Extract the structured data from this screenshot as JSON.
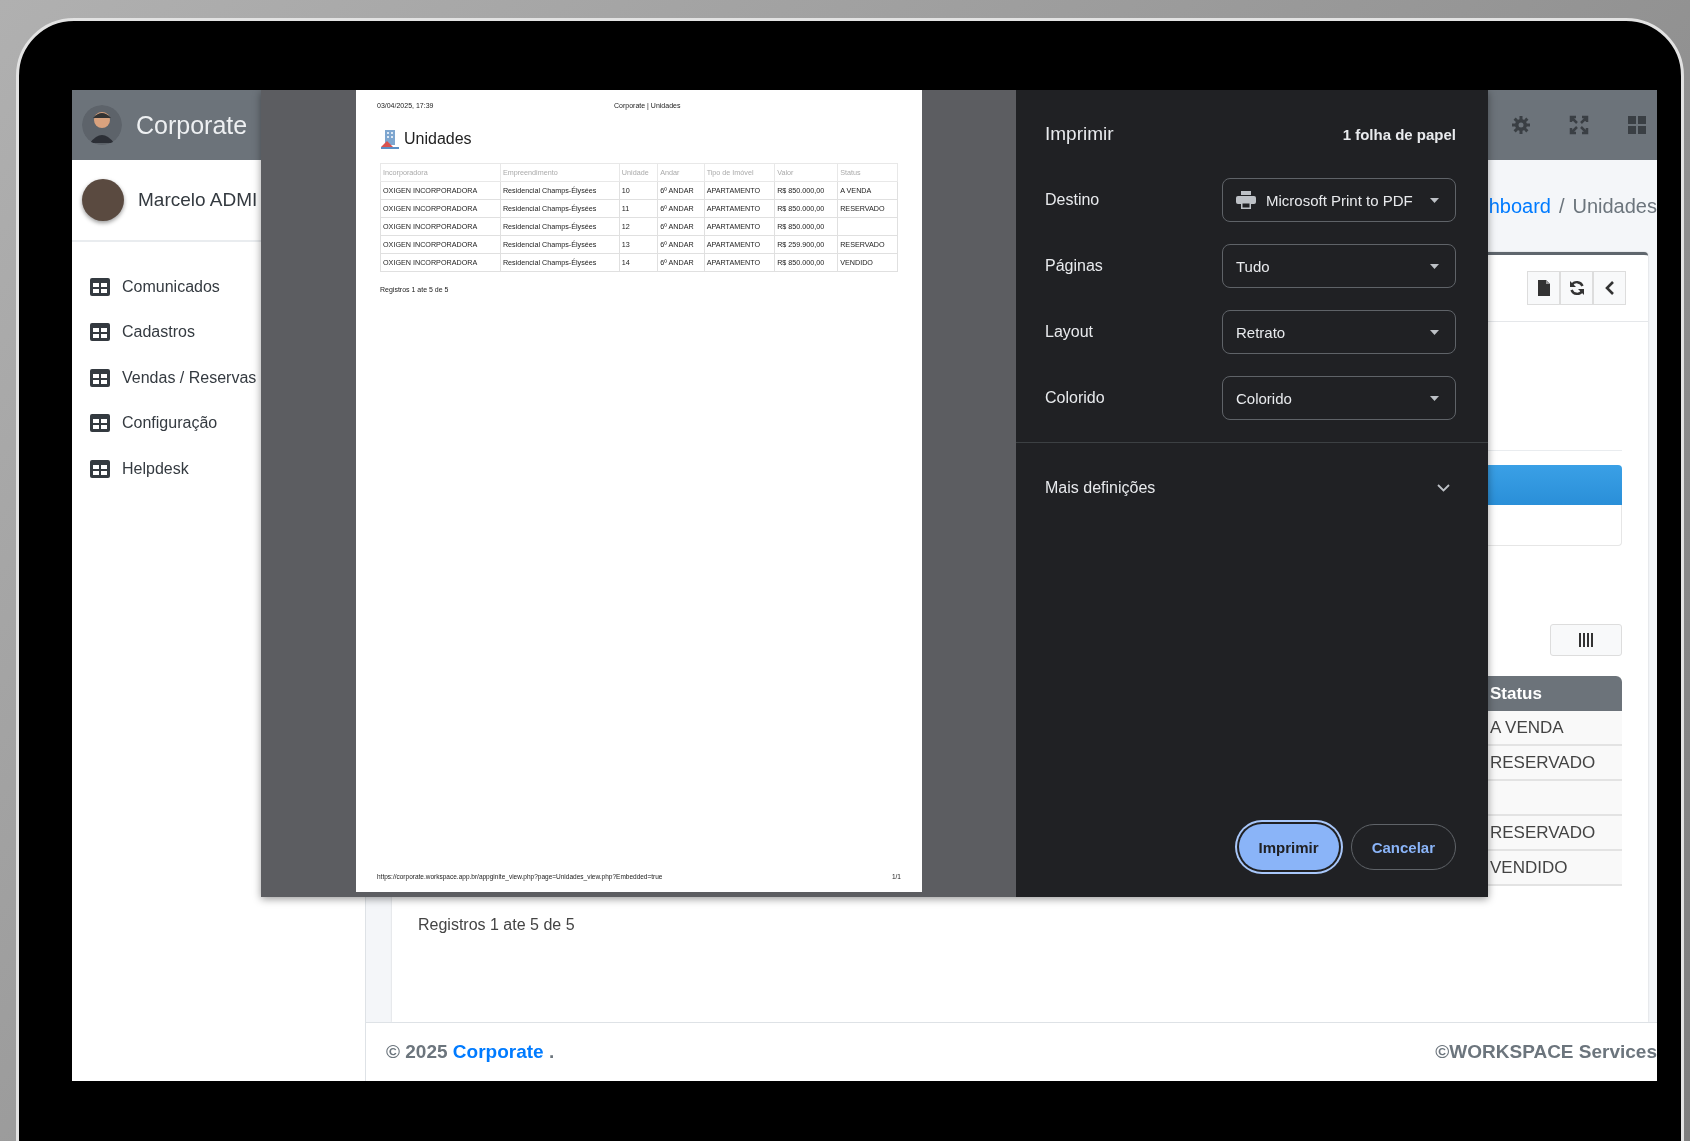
{
  "app": {
    "brand": "Corporate",
    "user": "Marcelo ADMI",
    "menu": [
      {
        "label": "Comunicados"
      },
      {
        "label": "Cadastros"
      },
      {
        "label": "Vendas / Reservas"
      },
      {
        "label": "Configuração"
      },
      {
        "label": "Helpdesk"
      }
    ],
    "breadcrumb": {
      "link": "hboard",
      "separator": "/",
      "current": "Unidades"
    },
    "status_column": {
      "header": "Status",
      "rows": [
        {
          "status": "A VENDA"
        },
        {
          "status": "RESERVADO"
        },
        {},
        {
          "status": "RESERVADO"
        },
        {
          "status": "VENDIDO"
        }
      ]
    },
    "records_info": "Registros 1 ate 5 de 5",
    "footer": {
      "copyright": "© 2025",
      "brand": "Corporate",
      "trail": ".",
      "credit": "©WORKSPACE Services"
    }
  },
  "print_dialog": {
    "preview": {
      "header_date": "03/04/2025, 17:39",
      "header_title": "Corporate | Unidades",
      "title": "Unidades",
      "columns": [
        "Incorporadora",
        "Empreendimento",
        "Unidade",
        "Andar",
        "Tipo de Imóvel",
        "Valor",
        "Status"
      ],
      "rows": [
        [
          "OXIGEN INCORPORADORA",
          "Residencial Champs-Élysées",
          "10",
          "6º ANDAR",
          "APARTAMENTO",
          "R$ 850.000,00",
          "A VENDA"
        ],
        [
          "OXIGEN INCORPORADORA",
          "Residencial Champs-Élysées",
          "11",
          "6º ANDAR",
          "APARTAMENTO",
          "R$ 850.000,00",
          "RESERVADO"
        ],
        [
          "OXIGEN INCORPORADORA",
          "Residencial Champs-Élysées",
          "12",
          "6º ANDAR",
          "APARTAMENTO",
          "R$ 850.000,00"
        ],
        [
          "OXIGEN INCORPORADORA",
          "Residencial Champs-Élysées",
          "13",
          "6º ANDAR",
          "APARTAMENTO",
          "R$ 259.900,00",
          "RESERVADO"
        ],
        [
          "OXIGEN INCORPORADORA",
          "Residencial Champs-Élysées",
          "14",
          "6º ANDAR",
          "APARTAMENTO",
          "R$ 850.000,00",
          "VENDIDO"
        ]
      ],
      "records_info": "Registros 1 ate 5 de 5",
      "url": "https://corporate.workspace.app.br/appginite_view.php?page=Unidades_view.php?Embedded=true",
      "page_number": "1/1"
    },
    "title": "Imprimir",
    "sheets": "1 folha de papel",
    "settings": [
      {
        "label": "Destino",
        "value": "Microsoft Print to PDF",
        "kind": "printer"
      },
      {
        "label": "Páginas",
        "value": "Tudo",
        "kind": "plain"
      },
      {
        "label": "Layout",
        "value": "Retrato",
        "kind": "plain"
      },
      {
        "label": "Colorido",
        "value": "Colorido",
        "kind": "plain"
      }
    ],
    "more": "Mais definições",
    "buttons": [
      {
        "label": "Imprimir",
        "kind": "primary"
      },
      {
        "label": "Cancelar",
        "kind": "secondary"
      }
    ]
  }
}
